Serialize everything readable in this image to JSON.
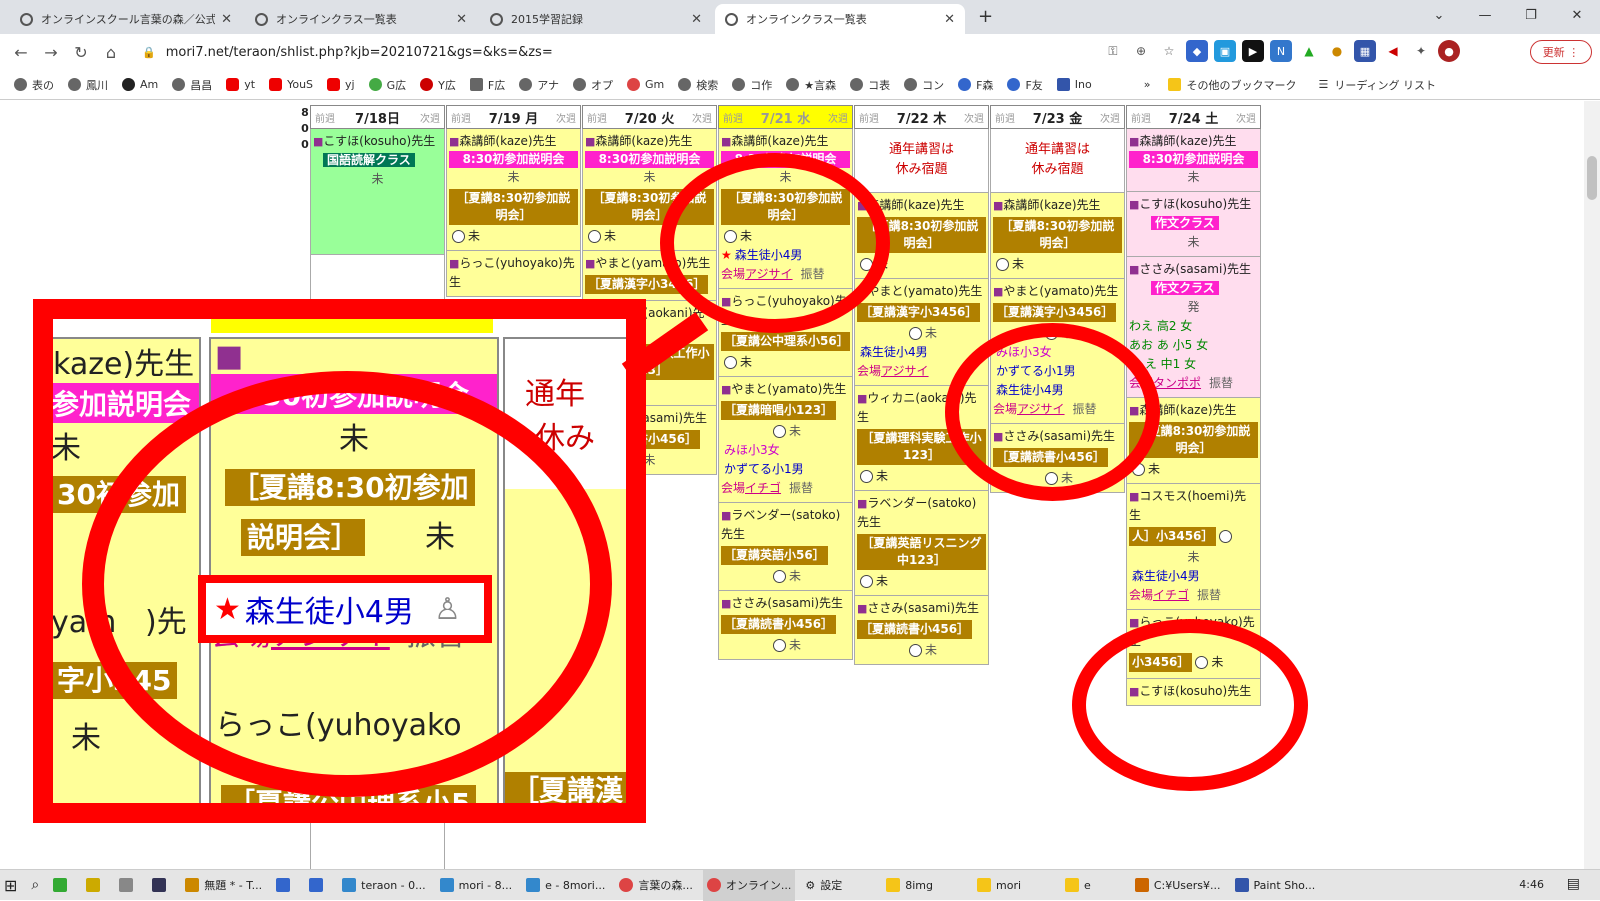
{
  "tabs": [
    {
      "title": "オンラインスクール言葉の森／公式ホ",
      "active": false
    },
    {
      "title": "オンラインクラス一覧表",
      "active": false
    },
    {
      "title": "2015学習記録",
      "active": false
    },
    {
      "title": "オンラインクラス一覧表",
      "active": true
    }
  ],
  "new_tab": "+",
  "window_controls": {
    "minimize": "—",
    "restore": "❐",
    "close": "✕"
  },
  "address_bar": {
    "url": "mori7.net/teraon/shlist.php?kjb=20210721&gs=&ks=&zs="
  },
  "update_button": "更新",
  "bookmarks": [
    "表の",
    "鳳川",
    "Am",
    "昌昌",
    "yt",
    "YouS",
    "yj",
    "G広",
    "Y広",
    "F広",
    "アナ",
    "オプ",
    "Gm",
    "検索",
    "コ作",
    "★言森",
    "コ表",
    "コン",
    "F森",
    "F友",
    "Ino"
  ],
  "bookmarks_more": "»",
  "other_bookmarks": "その他のブックマーク",
  "reading_list": "リーディング リスト",
  "hour_label": [
    "8",
    "0",
    "0"
  ],
  "days": [
    {
      "prev": "前週",
      "date": "7/18",
      "dow": "日",
      "next": "次週"
    },
    {
      "prev": "前週",
      "date": "7/19",
      "dow": "月",
      "next": "次週"
    },
    {
      "prev": "前週",
      "date": "7/20",
      "dow": "火",
      "next": "次週"
    },
    {
      "prev": "前週",
      "date": "7/21",
      "dow": "水",
      "next": "次週"
    },
    {
      "prev": "前週",
      "date": "7/22",
      "dow": "木",
      "next": "次週"
    },
    {
      "prev": "前週",
      "date": "7/23",
      "dow": "金",
      "next": "次週"
    },
    {
      "prev": "前週",
      "date": "7/24",
      "dow": "土",
      "next": "次週"
    }
  ],
  "teachers": {
    "kosuho": "こすほ(kosuho)先生",
    "kaze": "森講師(kaze)先生",
    "yuhoyako": "らっこ(yuhoyako)先生",
    "yamato": "やまと(yamato)先生",
    "aokani": "ウィカニ(aokani)先生",
    "satoko": "ラベンダー(satoko)先生",
    "sasami": "ささみ(sasami)先生",
    "hoemi": "コスモス(hoemi)先生"
  },
  "classes": {
    "kokugo": "国語読解クラス",
    "setsumei_pink": "8:30初参加説明会",
    "setsumei_box": "［夏講8:30初参加説明会］",
    "kanji": "［夏講漢字小3456］",
    "kanji_short": "［夏講漢字小345",
    "koumin": "［夏講公中理系小56］",
    "anshou": "［夏講暗唱小123］",
    "eigo": "［夏講英語小56］",
    "dokusho": "［夏講読書小456］",
    "rika": "［夏講理科実験工作小123］",
    "listening": "［夏講英語リスニング中123］",
    "sakubun": "作文クラス",
    "hoemi_cls": "人］小3456］",
    "yuhoyako_cls": "［夏講読書小456］",
    "yuhoyako_cls2": "小3456］"
  },
  "status_mi": "未",
  "furikae": "振替",
  "venue_prefix": "会場",
  "venues": {
    "ajisai": "アジサイ",
    "ichigo": "イチゴ",
    "tanpopo": "タンポポ"
  },
  "students": {
    "mori": "森生徒小4男",
    "miho": "みほ小3女",
    "kazuteru": "かずてる小1男",
    "wa": "わえ",
    "wa_grade": "高2 女",
    "aa": "あお あ",
    "aa_grade": "小5 女",
    "ae": "あ え",
    "ae_grade": "中1 女"
  },
  "holiday_notice": [
    "通年講習は",
    "休み宿題"
  ],
  "hatsu": "発",
  "zoom": {
    "teacher_kaze_frag": "kaze)先生",
    "pink_frag1": "参加説明会",
    "pink_frag2": ":30初参加説明会",
    "box_frag1": "［夏講8:30初参加",
    "box_frag2": "説明会］",
    "box_small": "30初参加",
    "yamato_frag": "yam",
    "yamato_frag2": ")先",
    "kanji_frag": "字小345",
    "rakko_frag": "らっこ(yuhoyako",
    "koumin_frag": "［夏講公中理系小5",
    "notice_frag1": "通年",
    "notice_frag2": "休み",
    "kanji_frag2": "［夏講漢",
    "highlight_student": "森生徒小4男",
    "venue_frag": "アジサイ"
  },
  "taskbar": {
    "items": [
      "無題 * - T...",
      "teraon - 0...",
      "mori - 8...",
      "e - 8mori...",
      "言葉の森...",
      "オンライン...",
      "設定",
      "8img",
      "mori",
      "e",
      "C:¥Users¥...",
      "Paint Sho..."
    ],
    "clock": "4:46"
  }
}
